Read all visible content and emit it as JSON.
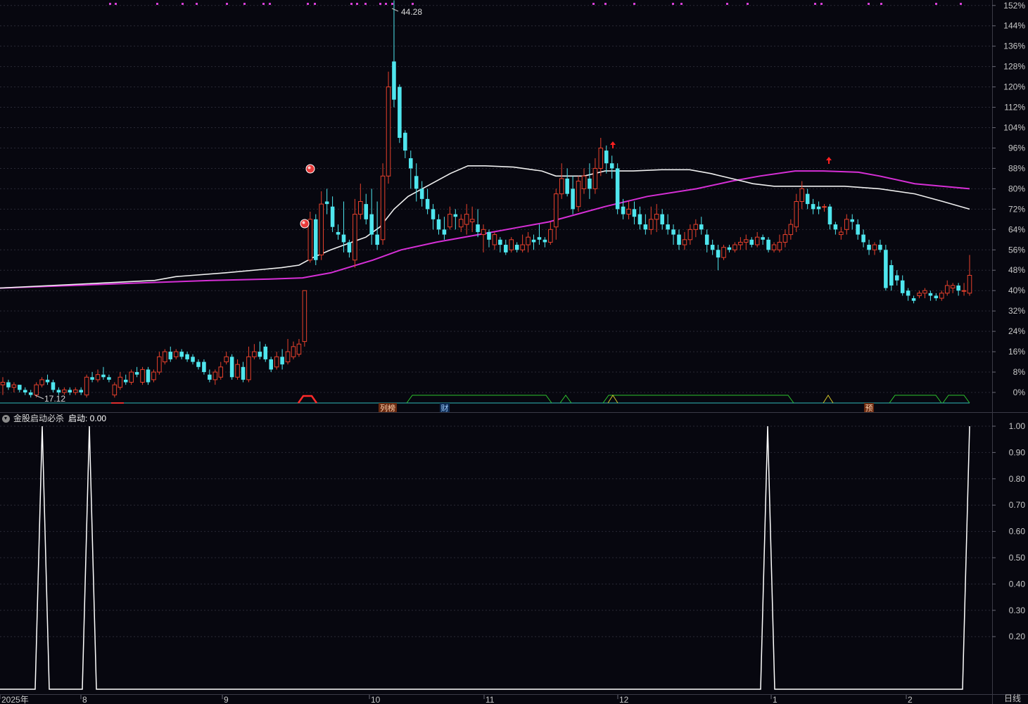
{
  "chart_data": {
    "type": "candlestick",
    "y_axis_labels": [
      "152%",
      "144%",
      "136%",
      "128%",
      "120%",
      "112%",
      "104%",
      "96%",
      "88%",
      "80%",
      "72%",
      "64%",
      "56%",
      "48%",
      "40%",
      "32%",
      "24%",
      "16%",
      "8%",
      "0%"
    ],
    "y_axis_values": [
      152,
      144,
      136,
      128,
      120,
      112,
      104,
      96,
      88,
      80,
      72,
      64,
      56,
      48,
      40,
      32,
      24,
      16,
      8,
      0
    ],
    "ylim": [
      -1,
      156
    ],
    "x_labels": [
      "2025年",
      "8",
      "9",
      "10",
      "11",
      "12",
      "1",
      "2"
    ],
    "high_annotation": "44.28",
    "low_annotation": "17.12",
    "candles": [
      [
        3,
        4,
        -1,
        6
      ],
      [
        4,
        2,
        1,
        5
      ],
      [
        2,
        3,
        0,
        4
      ],
      [
        3,
        1,
        0,
        3
      ],
      [
        1,
        0,
        -1,
        2
      ],
      [
        0,
        -1,
        -2,
        1
      ],
      [
        -1,
        3,
        -2,
        4
      ],
      [
        3,
        5,
        2,
        6
      ],
      [
        5,
        4,
        3,
        7
      ],
      [
        4,
        1,
        0,
        5
      ],
      [
        1,
        0,
        -1,
        2
      ],
      [
        0,
        1,
        -1,
        2
      ],
      [
        1,
        0,
        -1,
        2
      ],
      [
        0,
        1,
        -1,
        2
      ],
      [
        1,
        0,
        -1,
        2
      ],
      [
        -1,
        6,
        -2,
        7
      ],
      [
        6,
        5,
        4,
        8
      ],
      [
        5,
        7,
        4,
        9
      ],
      [
        7,
        6,
        5,
        10
      ],
      [
        6,
        5,
        4,
        7
      ],
      [
        -1,
        3,
        -2,
        4
      ],
      [
        2,
        6,
        1,
        8
      ],
      [
        5,
        4,
        3,
        7
      ],
      [
        4,
        8,
        3,
        9
      ],
      [
        8,
        7,
        6,
        10
      ],
      [
        4,
        9,
        3,
        10
      ],
      [
        9,
        4,
        3,
        10
      ],
      [
        5,
        8,
        4,
        9
      ],
      [
        8,
        14,
        7,
        16
      ],
      [
        12,
        16,
        11,
        17
      ],
      [
        16,
        13,
        12,
        18
      ],
      [
        14,
        16,
        13,
        17
      ],
      [
        16,
        14,
        13,
        17
      ],
      [
        15,
        13,
        12,
        16
      ],
      [
        14,
        12,
        11,
        15
      ],
      [
        12,
        10,
        9,
        13
      ],
      [
        12,
        8,
        7,
        13
      ],
      [
        7,
        5,
        4,
        9
      ],
      [
        5,
        8,
        3,
        9
      ],
      [
        6,
        10,
        5,
        12
      ],
      [
        12,
        14,
        11,
        16
      ],
      [
        14,
        6,
        5,
        15
      ],
      [
        6,
        11,
        5,
        13
      ],
      [
        10,
        5,
        4,
        12
      ],
      [
        5,
        14,
        4,
        18
      ],
      [
        14,
        16,
        13,
        19
      ],
      [
        16,
        14,
        13,
        20
      ],
      [
        18,
        13,
        12,
        19
      ],
      [
        13,
        9,
        8,
        14
      ],
      [
        10,
        14,
        9,
        16
      ],
      [
        14,
        11,
        9,
        17
      ],
      [
        12,
        16,
        11,
        21
      ],
      [
        14,
        18,
        13,
        20
      ],
      [
        15,
        19,
        14,
        21
      ],
      [
        20,
        40,
        18,
        40
      ],
      [
        52,
        68,
        51,
        71
      ],
      [
        68,
        52,
        50,
        70
      ],
      [
        54,
        74,
        52,
        79
      ],
      [
        75,
        74,
        70,
        80
      ],
      [
        73,
        65,
        63,
        77
      ],
      [
        63,
        62,
        60,
        66
      ],
      [
        62,
        59,
        55,
        75
      ],
      [
        59,
        55,
        53,
        60
      ],
      [
        52,
        70,
        49,
        76
      ],
      [
        70,
        75,
        68,
        82
      ],
      [
        74,
        68,
        66,
        78
      ],
      [
        70,
        62,
        58,
        80
      ],
      [
        62,
        58,
        56,
        75
      ],
      [
        60,
        85,
        58,
        90
      ],
      [
        85,
        120,
        82,
        126
      ],
      [
        130,
        115,
        112,
        154
      ],
      [
        120,
        100,
        98,
        121
      ],
      [
        102,
        95,
        92,
        103
      ],
      [
        92,
        88,
        80,
        95
      ],
      [
        85,
        80,
        75,
        90
      ],
      [
        80,
        76,
        73,
        83
      ],
      [
        76,
        72,
        70,
        80
      ],
      [
        72,
        68,
        64,
        74
      ],
      [
        68,
        64,
        62,
        70
      ],
      [
        64,
        62,
        60,
        69
      ],
      [
        65,
        70,
        64,
        73
      ],
      [
        70,
        69,
        64,
        72
      ],
      [
        65,
        68,
        63,
        70
      ],
      [
        66,
        70,
        62,
        74
      ],
      [
        67,
        68,
        63,
        73
      ],
      [
        66,
        63,
        61,
        72
      ],
      [
        62,
        64,
        55,
        66
      ],
      [
        63,
        60,
        57,
        64
      ],
      [
        58,
        62,
        56,
        63
      ],
      [
        60,
        58,
        55,
        61
      ],
      [
        58,
        55,
        54,
        60
      ],
      [
        56,
        60,
        55,
        61
      ],
      [
        58,
        56,
        55,
        59
      ],
      [
        56,
        58,
        55,
        62
      ],
      [
        58,
        61,
        55,
        63
      ],
      [
        60,
        59,
        56,
        62
      ],
      [
        61,
        60,
        58,
        66
      ],
      [
        60,
        59,
        57,
        61
      ],
      [
        59,
        64,
        58,
        67
      ],
      [
        65,
        78,
        60,
        80
      ],
      [
        78,
        84,
        76,
        90
      ],
      [
        84,
        78,
        77,
        88
      ],
      [
        80,
        72,
        70,
        85
      ],
      [
        73,
        83,
        71,
        85
      ],
      [
        80,
        85,
        78,
        88
      ],
      [
        84,
        80,
        76,
        90
      ],
      [
        80,
        88,
        78,
        92
      ],
      [
        88,
        96,
        85,
        100
      ],
      [
        95,
        90,
        86,
        97
      ],
      [
        90,
        88,
        84,
        93
      ],
      [
        88,
        72,
        70,
        90
      ],
      [
        73,
        70,
        68,
        76
      ],
      [
        70,
        72,
        68,
        75
      ],
      [
        72,
        69,
        66,
        75
      ],
      [
        70,
        66,
        64,
        73
      ],
      [
        66,
        64,
        62,
        70
      ],
      [
        64,
        68,
        62,
        73
      ],
      [
        68,
        70,
        63,
        74
      ],
      [
        70,
        66,
        64,
        72
      ],
      [
        66,
        64,
        62,
        70
      ],
      [
        64,
        62,
        58,
        66
      ],
      [
        62,
        58,
        56,
        64
      ],
      [
        58,
        60,
        56,
        63
      ],
      [
        60,
        64,
        58,
        66
      ],
      [
        64,
        66,
        61,
        68
      ],
      [
        66,
        64,
        62,
        69
      ],
      [
        62,
        58,
        55,
        64
      ],
      [
        58,
        56,
        54,
        60
      ],
      [
        56,
        53,
        48,
        58
      ],
      [
        53,
        57,
        52,
        58
      ],
      [
        57,
        56,
        55,
        58
      ],
      [
        56,
        58,
        55,
        59
      ],
      [
        58,
        59,
        56,
        61
      ],
      [
        59,
        60,
        56,
        62
      ],
      [
        60,
        58,
        57,
        61
      ],
      [
        58,
        61,
        57,
        63
      ],
      [
        61,
        60,
        58,
        62
      ],
      [
        60,
        56,
        55,
        61
      ],
      [
        56,
        58,
        55,
        59
      ],
      [
        56,
        59,
        55,
        62
      ],
      [
        59,
        62,
        57,
        64
      ],
      [
        62,
        66,
        60,
        68
      ],
      [
        65,
        75,
        63,
        78
      ],
      [
        75,
        80,
        72,
        83
      ],
      [
        78,
        74,
        72,
        80
      ],
      [
        74,
        72,
        70,
        76
      ],
      [
        73,
        72,
        70,
        75
      ],
      [
        73,
        73,
        71,
        74
      ],
      [
        73,
        66,
        64,
        74
      ],
      [
        66,
        64,
        62,
        67
      ],
      [
        62,
        63,
        60,
        65
      ],
      [
        64,
        68,
        62,
        70
      ],
      [
        68,
        67,
        64,
        70
      ],
      [
        66,
        62,
        60,
        68
      ],
      [
        62,
        59,
        57,
        64
      ],
      [
        58,
        56,
        54,
        60
      ],
      [
        56,
        58,
        54,
        59
      ],
      [
        58,
        56,
        55,
        60
      ],
      [
        56,
        41,
        40,
        58
      ],
      [
        50,
        42,
        40,
        52
      ],
      [
        46,
        44,
        42,
        48
      ],
      [
        44,
        39,
        38,
        46
      ],
      [
        40,
        38,
        36,
        41
      ],
      [
        37,
        36,
        35,
        38
      ],
      [
        38,
        39,
        37,
        40
      ],
      [
        39,
        40,
        37,
        41
      ],
      [
        39,
        38,
        36,
        40
      ],
      [
        38,
        37,
        36,
        39
      ],
      [
        37,
        39,
        36,
        40
      ],
      [
        39,
        42,
        38,
        44
      ],
      [
        41,
        42,
        39,
        43
      ],
      [
        42,
        40,
        38,
        43
      ],
      [
        40,
        40,
        38,
        43
      ],
      [
        39,
        46,
        38,
        54
      ]
    ],
    "ma_white": [
      [
        0,
        41
      ],
      [
        220,
        44
      ],
      [
        250,
        45.5
      ],
      [
        320,
        47
      ],
      [
        400,
        49
      ],
      [
        425,
        50
      ],
      [
        445,
        53
      ],
      [
        470,
        56
      ],
      [
        500,
        59
      ],
      [
        520,
        61
      ],
      [
        540,
        65
      ],
      [
        560,
        72
      ],
      [
        580,
        77
      ],
      [
        600,
        80
      ],
      [
        640,
        86
      ],
      [
        665,
        89
      ],
      [
        690,
        89
      ],
      [
        730,
        88.5
      ],
      [
        770,
        87
      ],
      [
        790,
        85
      ],
      [
        830,
        85
      ],
      [
        860,
        87
      ],
      [
        900,
        87
      ],
      [
        940,
        87.5
      ],
      [
        980,
        87.5
      ],
      [
        1010,
        86
      ],
      [
        1040,
        84
      ],
      [
        1070,
        82
      ],
      [
        1100,
        81
      ],
      [
        1150,
        81
      ],
      [
        1200,
        81
      ],
      [
        1250,
        80
      ],
      [
        1300,
        78
      ],
      [
        1340,
        75
      ],
      [
        1378,
        72
      ]
    ],
    "ma_magenta": [
      [
        0,
        41
      ],
      [
        100,
        42
      ],
      [
        200,
        43
      ],
      [
        300,
        44
      ],
      [
        380,
        44.5
      ],
      [
        430,
        45
      ],
      [
        470,
        47
      ],
      [
        530,
        52
      ],
      [
        570,
        56
      ],
      [
        620,
        59
      ],
      [
        680,
        62
      ],
      [
        740,
        65
      ],
      [
        780,
        67
      ],
      [
        820,
        70
      ],
      [
        860,
        73
      ],
      [
        920,
        77
      ],
      [
        990,
        80
      ],
      [
        1040,
        83
      ],
      [
        1080,
        85
      ],
      [
        1130,
        87
      ],
      [
        1170,
        87
      ],
      [
        1220,
        86.5
      ],
      [
        1250,
        85
      ],
      [
        1300,
        82
      ],
      [
        1378,
        80
      ]
    ],
    "dots_x": [
      155,
      163,
      222,
      258,
      278,
      321,
      346,
      373,
      382,
      436,
      446,
      498,
      506,
      518,
      539,
      547,
      556,
      585,
      842,
      859,
      900,
      955,
      967,
      1032,
      1061,
      1157,
      1166,
      1233,
      1251,
      1329,
      1364
    ],
    "ball_markers": [
      [
        441,
        240
      ],
      [
        433,
        318
      ]
    ],
    "up_arrows": [
      [
        871,
        206
      ],
      [
        1178,
        228
      ]
    ],
    "lower_labels": [
      {
        "text": "列榜",
        "x": 551
      },
      {
        "text": "财",
        "x": 632
      },
      {
        "text": "预",
        "x": 1235
      }
    ],
    "indicator": {
      "title": "金股启动必杀",
      "value_label": "启动: 0.00",
      "y_axis_labels": [
        "1.00",
        "0.90",
        "0.80",
        "0.70",
        "0.60",
        "0.50",
        "0.40",
        "0.30",
        "0.20"
      ],
      "y_axis_values": [
        1.0,
        0.9,
        0.8,
        0.7,
        0.6,
        0.5,
        0.4,
        0.3,
        0.2
      ],
      "spikes_x": [
        60,
        127,
        1091,
        1378
      ]
    },
    "period_label": "日线"
  }
}
